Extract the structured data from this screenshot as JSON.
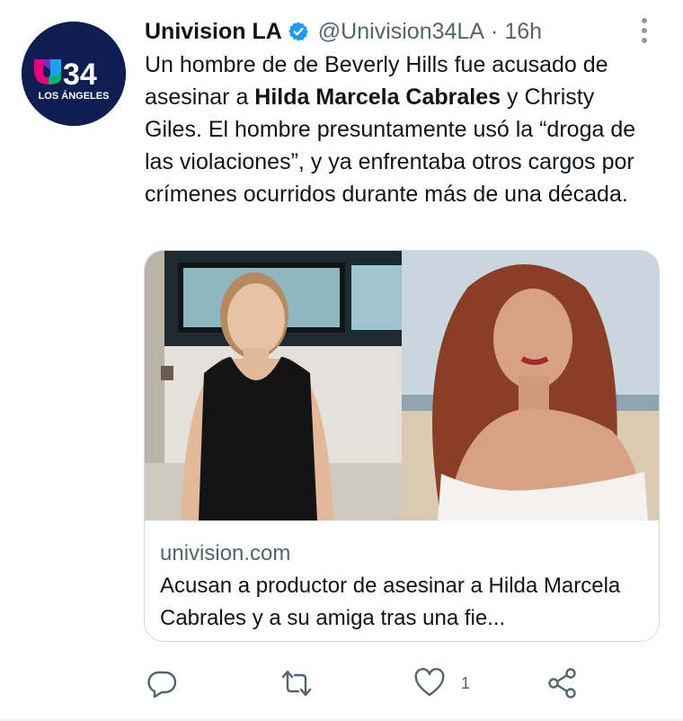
{
  "account": {
    "name": "Univision LA",
    "handle": "@Univision34LA",
    "separator": "·",
    "time": "16h",
    "avatar_label_number": "34",
    "avatar_label_city": "LOS ÁNGELES",
    "verified_icon": "verified-badge-icon"
  },
  "tweet": {
    "text_1": "Un hombre de de Beverly Hills fue acusado de asesinar a ",
    "text_bold": "Hilda Marcela Cabrales",
    "text_2": " y Christy Giles. El hombre presuntamente usó la “droga de las violaciones”, y ya enfrentaba otros cargos por crímenes ocurridos durante más de una década."
  },
  "card": {
    "domain": "univision.com",
    "title": "Acusan a productor de asesinar a Hilda Marcela Cabrales y a su amiga tras una fie..."
  },
  "actions": {
    "reply_icon": "reply-icon",
    "retweet_icon": "retweet-icon",
    "like_icon": "like-icon",
    "like_count": "1",
    "share_icon": "share-icon"
  },
  "colors": {
    "text_primary": "#0f1419",
    "text_secondary": "#536471",
    "verified_blue": "#1d9bf0",
    "border": "#cfd9de",
    "avatar_bg": "#0e1e52"
  }
}
